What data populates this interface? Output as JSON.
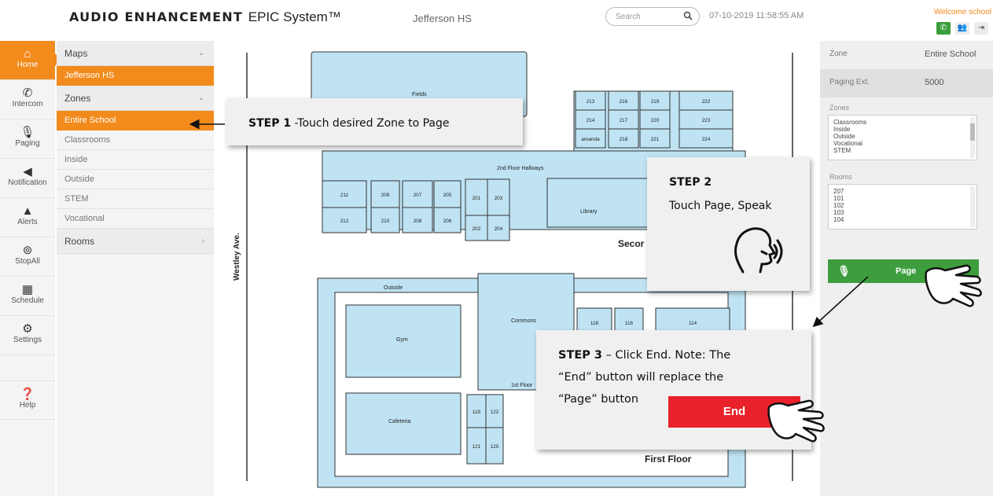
{
  "header": {
    "brand_bold": "AUDIO ENHANCEMENT",
    "brand_rest": "EPIC System™",
    "school": "Jefferson HS",
    "search_placeholder": "Search",
    "datetime": "07-10-2019 11:58:55 AM",
    "welcome": "Welcome school"
  },
  "rail": {
    "items": [
      {
        "label": "Home",
        "icon": "home-icon"
      },
      {
        "label": "Intercom",
        "icon": "phone-icon"
      },
      {
        "label": "Paging",
        "icon": "microphone-icon"
      },
      {
        "label": "Notification",
        "icon": "speaker-icon"
      },
      {
        "label": "Alerts",
        "icon": "warning-icon"
      },
      {
        "label": "StopAll",
        "icon": "stop-icon"
      },
      {
        "label": "Schedule",
        "icon": "calendar-icon"
      },
      {
        "label": "Settings",
        "icon": "gear-icon"
      },
      {
        "label": "Help",
        "icon": "help-icon"
      }
    ]
  },
  "menu": {
    "maps_label": "Maps",
    "maps_items": [
      "Jefferson HS"
    ],
    "zones_label": "Zones",
    "zones_items": [
      "Entire School",
      "Classrooms",
      "Inside",
      "Outside",
      "STEM",
      "Vocational"
    ],
    "rooms_label": "Rooms"
  },
  "map": {
    "street": "Westley Ave.",
    "second_floor": {
      "fields": "Fields",
      "hallways": "2nd Floor Hallways",
      "library": "Library",
      "title": "Secor",
      "rooms": [
        "213",
        "216",
        "219",
        "222",
        "214",
        "217",
        "220",
        "223",
        "amanda",
        "218",
        "221",
        "224",
        "211",
        "209",
        "207",
        "205",
        "201",
        "203",
        "212",
        "210",
        "208",
        "206",
        "202",
        "204"
      ]
    },
    "first_floor": {
      "outside": "Outside",
      "commons": "Commons",
      "gym": "Gym",
      "hall": "1st Floor",
      "cafeteria": "Cafeteria",
      "title": "First Floor",
      "rooms": [
        "118",
        "116",
        "114",
        "119",
        "122",
        "121",
        "120"
      ]
    }
  },
  "rpanel": {
    "zone_label": "Zone",
    "zone_value": "Entire School",
    "ext_label": "Paging Ext.",
    "ext_value": "5000",
    "zones_title": "Zones",
    "zones_list": [
      "Classrooms",
      "Inside",
      "Outside",
      "Vocational",
      "STEM"
    ],
    "rooms_title": "Rooms",
    "rooms_list": [
      "207",
      "101",
      "102",
      "103",
      "104"
    ],
    "page_button": "Page"
  },
  "steps": {
    "step1_bold": "STEP 1",
    "step1_text": " -Touch desired Zone to Page",
    "step2_bold": "STEP 2",
    "step2_text": "Touch Page, Speak",
    "step3_bold": "STEP 3",
    "step3_line1": " – Click End. Note: The",
    "step3_line2": "“End” button will replace the",
    "step3_line3": "“Page” button",
    "end_button": "End"
  },
  "colors": {
    "accent": "#f28a1c",
    "green": "#3e9e3e",
    "end_red": "#e8212a",
    "map_fill": "#bfe3f3"
  }
}
